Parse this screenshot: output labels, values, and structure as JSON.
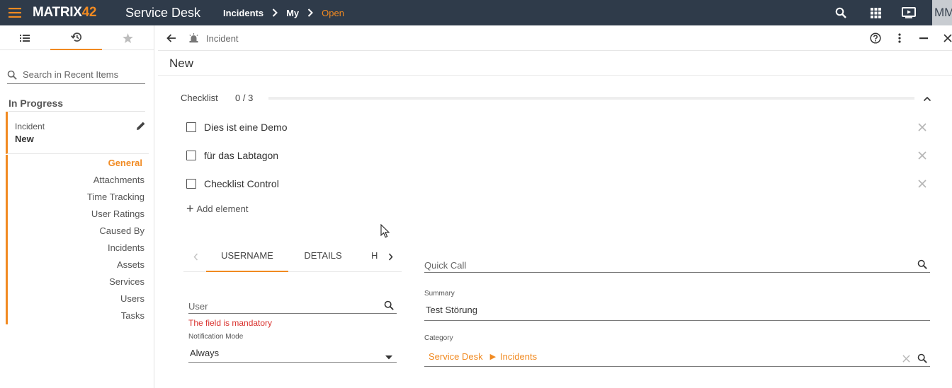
{
  "topbar": {
    "logo_prefix": "MATRIX",
    "logo_suffix": "42",
    "app_title": "Service Desk",
    "breadcrumb": [
      "Incidents",
      "My",
      "Open"
    ],
    "avatar_initials": "MM",
    "icons": [
      "menu-icon",
      "search-icon",
      "apps-grid-icon",
      "presentation-icon"
    ]
  },
  "left_panel": {
    "tabs": [
      "list-icon",
      "history-icon",
      "star-icon"
    ],
    "search_placeholder": "Search in Recent Items",
    "section_title": "In Progress",
    "item": {
      "type": "Incident",
      "name": "New"
    },
    "nav": [
      "General",
      "Attachments",
      "Time Tracking",
      "User Ratings",
      "Caused By",
      "Incidents",
      "Assets",
      "Services",
      "Users",
      "Tasks"
    ],
    "active_nav": "General"
  },
  "main": {
    "toolbar": {
      "type_label": "Incident"
    },
    "title": "New",
    "checklist": {
      "title": "Checklist",
      "count": "0 / 3",
      "progress": 0,
      "items": [
        {
          "label": "Dies ist eine Demo",
          "checked": false
        },
        {
          "label": "für das Labtagon",
          "checked": false
        },
        {
          "label": "Checklist Control",
          "checked": false
        }
      ],
      "add_label": "Add element"
    },
    "tabs": [
      "USERNAME",
      "DETAILS",
      "H"
    ],
    "active_tab": "USERNAME",
    "user": {
      "placeholder": "User",
      "error": "The field is mandatory"
    },
    "notification": {
      "label": "Notification Mode",
      "value": "Always"
    },
    "quick_call": {
      "placeholder": "Quick Call"
    },
    "summary": {
      "label": "Summary",
      "value": "Test Störung"
    },
    "category": {
      "label": "Category",
      "path": [
        "Service Desk",
        "Incidents"
      ]
    }
  },
  "colors": {
    "topbar": "#2f3b4a",
    "accent": "#f18a21",
    "error": "#d9302c"
  }
}
